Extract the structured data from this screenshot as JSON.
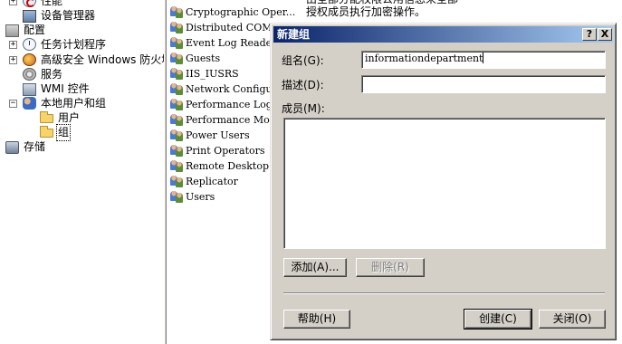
{
  "tree": {
    "items": [
      {
        "label": "性能",
        "icon": "performance-icon",
        "expander": "+"
      },
      {
        "label": "设备管理器",
        "icon": "device-manager-icon",
        "expander": ""
      },
      {
        "label": "配置",
        "icon": "configuration-icon",
        "expander": ""
      },
      {
        "label": "任务计划程序",
        "icon": "task-scheduler-icon",
        "expander": "+"
      },
      {
        "label": "高级安全 Windows 防火墙",
        "icon": "firewall-icon",
        "expander": "+"
      },
      {
        "label": "服务",
        "icon": "services-icon",
        "expander": ""
      },
      {
        "label": "WMI 控件",
        "icon": "wmi-icon",
        "expander": ""
      },
      {
        "label": "本地用户和组",
        "icon": "local-users-icon",
        "expander": "−"
      },
      {
        "label": "用户",
        "icon": "folder-icon",
        "expander": ""
      },
      {
        "label": "组",
        "icon": "folder-icon",
        "expander": ""
      },
      {
        "label": "存储",
        "icon": "storage-icon",
        "expander": ""
      }
    ]
  },
  "list": {
    "header_fragment": "由全部分配权限公用信息来全部",
    "rows": [
      {
        "name": "Cryptographic Oper...",
        "desc": "授权成员执行加密操作。"
      },
      {
        "name": "Distributed COM Users",
        "desc": ""
      },
      {
        "name": "Event Log Readers",
        "desc": ""
      },
      {
        "name": "Guests",
        "desc": ""
      },
      {
        "name": "IIS_IUSRS",
        "desc": ""
      },
      {
        "name": "Network Configuration Operators",
        "desc": ""
      },
      {
        "name": "Performance Log Users",
        "desc": ""
      },
      {
        "name": "Performance Monitor Users",
        "desc": ""
      },
      {
        "name": "Power Users",
        "desc": ""
      },
      {
        "name": "Print Operators",
        "desc": ""
      },
      {
        "name": "Remote Desktop Users",
        "desc": ""
      },
      {
        "name": "Replicator",
        "desc": ""
      },
      {
        "name": "Users",
        "desc": ""
      }
    ]
  },
  "dialog": {
    "title": "新建组",
    "help_btn": "?",
    "close_btn": "X",
    "group_name_label": "组名(G):",
    "group_name_value": "informationdepartment",
    "description_label": "描述(D):",
    "description_value": "",
    "members_label": "成员(M):",
    "add_btn": "添加(A)...",
    "remove_btn": "删除(R)",
    "help_button": "帮助(H)",
    "create_btn": "创建(C)",
    "close_button": "关闭(O)"
  },
  "colors": {
    "titlebar_start": "#0a246a",
    "titlebar_end": "#a6caf0",
    "dialog_face": "#d4d0c8"
  }
}
